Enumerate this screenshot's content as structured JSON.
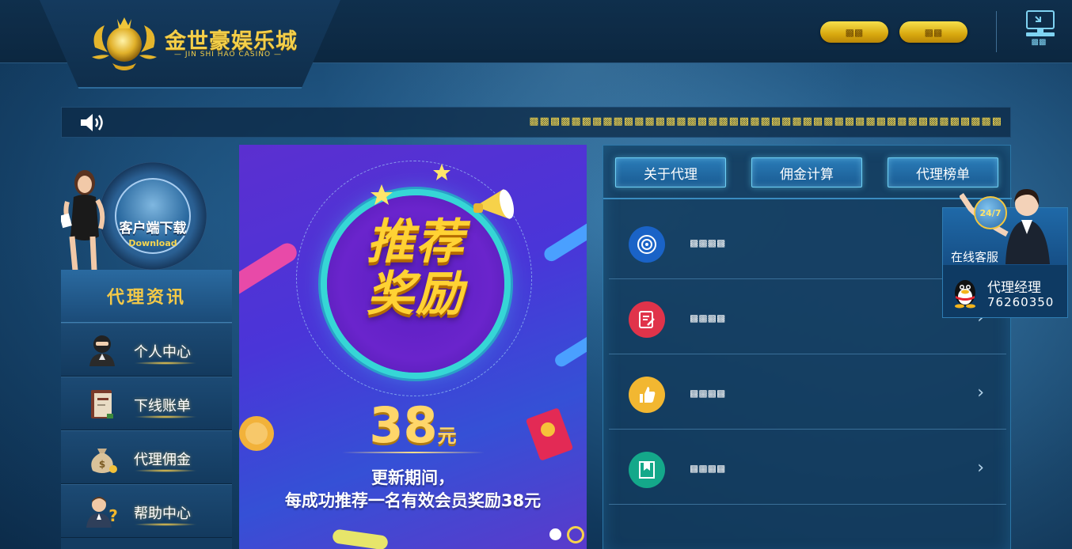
{
  "header": {
    "logo_cn": "金世豪娱乐城",
    "logo_en": "JIN SHI HAO CASINO",
    "buttons": [
      "▩▩",
      "▩▩"
    ],
    "pc_label": "▩▩"
  },
  "marquee": {
    "text": "▩▩▩▩▩▩▩▩▩▩▩▩▩▩▩▩▩▩▩▩▩▩▩▩▩▩▩▩▩▩▩▩▩▩▩▩▩▩▩▩▩▩▩▩▩"
  },
  "download": {
    "title": "客户端下载",
    "subtitle": "Download"
  },
  "left_nav": {
    "heading": "代理资讯",
    "items": [
      {
        "label": "个人中心",
        "icon": "ninja-avatar-icon"
      },
      {
        "label": "下线账单",
        "icon": "ledger-book-icon"
      },
      {
        "label": "代理佣金",
        "icon": "money-bag-icon"
      },
      {
        "label": "帮助中心",
        "icon": "help-person-icon"
      }
    ]
  },
  "banner": {
    "title_line1": "推荐",
    "title_line2": "奖励",
    "amount": "38",
    "unit": "元",
    "line1": "更新期间，",
    "line2": "每成功推荐一名有效会员奖励38元"
  },
  "panel": {
    "tabs": [
      "关于代理",
      "佣金计算",
      "代理榜单"
    ],
    "rows": [
      {
        "label": "▩▩▩▩",
        "icon": "target-icon",
        "color": "#1a63c7"
      },
      {
        "label": "▩▩▩▩",
        "icon": "edit-document-icon",
        "color": "#e0334a"
      },
      {
        "label": "▩▩▩▩",
        "icon": "thumbs-up-icon",
        "color": "#f2b731"
      },
      {
        "label": "▩▩▩▩",
        "icon": "bookmark-board-icon",
        "color": "#14a88a"
      }
    ]
  },
  "service": {
    "badge": "24/7",
    "label": "在线客服",
    "manager_title": "代理经理",
    "manager_number": "76260350"
  }
}
